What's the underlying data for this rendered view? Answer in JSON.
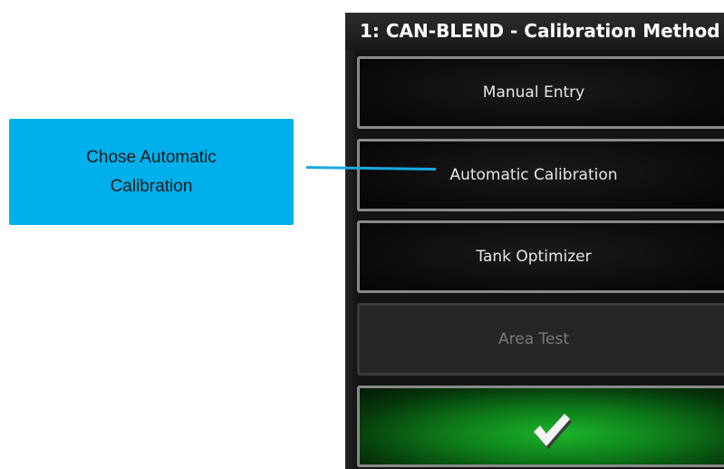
{
  "callout": {
    "text": "Chose Automatic Calibration",
    "color": "#00b0ec"
  },
  "dialog": {
    "title": "1: CAN-BLEND - Calibration Method",
    "options": [
      {
        "label": "Manual Entry",
        "enabled": true
      },
      {
        "label": "Automatic Calibration",
        "enabled": true
      },
      {
        "label": "Tank Optimizer",
        "enabled": true
      },
      {
        "label": "Area Test",
        "enabled": false
      }
    ],
    "confirm": {
      "icon": "checkmark-icon",
      "color": "#1bb52a"
    }
  }
}
